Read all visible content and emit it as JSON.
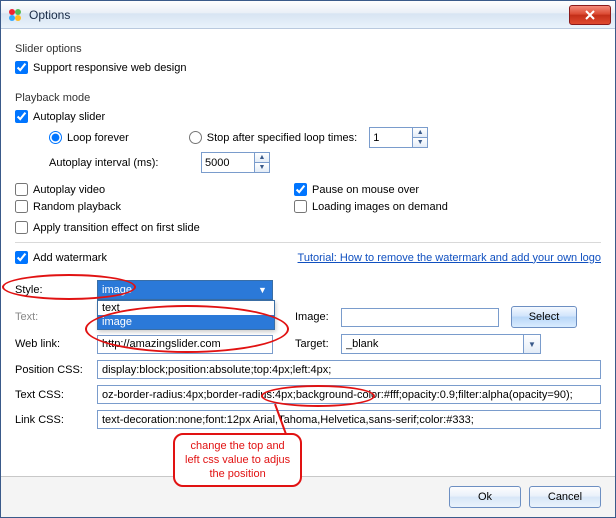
{
  "window": {
    "title": "Options"
  },
  "slider_options": {
    "group_title": "Slider options",
    "support_responsive_label": "Support responsive web design"
  },
  "playback": {
    "group_title": "Playback mode",
    "autoplay_slider_label": "Autoplay slider",
    "loop_forever_label": "Loop forever",
    "stop_after_label": "Stop after specified loop times:",
    "loop_times_value": "1",
    "interval_label": "Autoplay interval (ms):",
    "interval_value": "5000",
    "autoplay_video_label": "Autoplay video",
    "pause_on_mouse_label": "Pause on mouse over",
    "random_playback_label": "Random playback",
    "loading_images_label": "Loading images on demand",
    "apply_transition_label": "Apply transition effect on first slide"
  },
  "watermark": {
    "add_watermark_label": "Add watermark",
    "tutorial_label": "Tutorial: How to remove the watermark and add your own logo",
    "style_label": "Style:",
    "style_selected": "image",
    "style_options": {
      "opt_text": "text",
      "opt_image": "image"
    },
    "text_label": "Text:",
    "text_value": "",
    "image_label": "Image:",
    "image_value": "",
    "select_btn": "Select",
    "weblink_label": "Web link:",
    "weblink_value": "http://amazingslider.com",
    "target_label": "Target:",
    "target_value": "_blank",
    "position_css_label": "Position CSS:",
    "position_css_value": "display:block;position:absolute;top:4px;left:4px;",
    "text_css_label": "Text CSS:",
    "text_css_value": "oz-border-radius:4px;border-radius:4px;background-color:#fff;opacity:0.9;filter:alpha(opacity=90);",
    "link_css_label": "Link CSS:",
    "link_css_value": "text-decoration:none;font:12px Arial,Tahoma,Helvetica,sans-serif;color:#333;"
  },
  "annotation": {
    "text_line1": "change the top and",
    "text_line2": "left css value to adjus",
    "text_line3": "the position"
  },
  "buttons": {
    "ok": "Ok",
    "cancel": "Cancel"
  }
}
